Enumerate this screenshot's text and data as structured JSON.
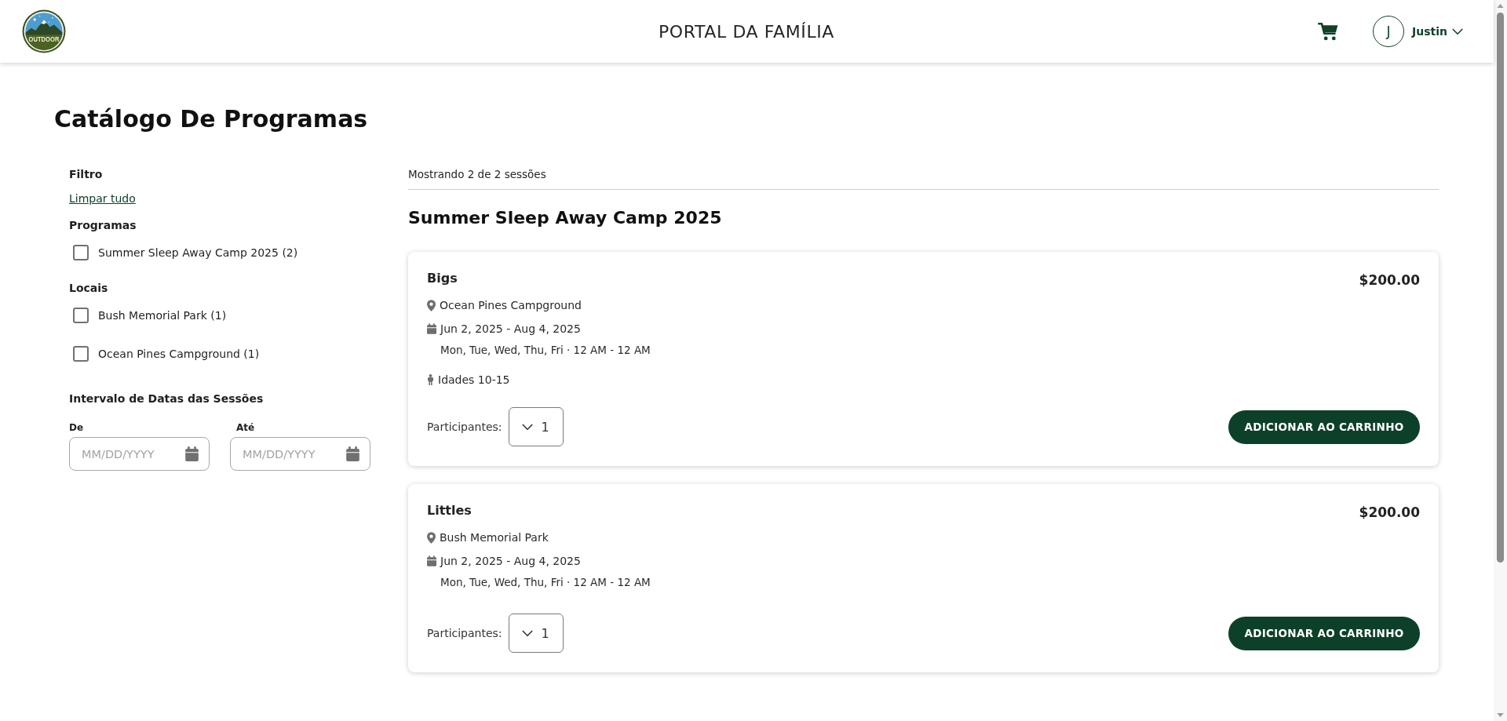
{
  "header": {
    "logo_text": "OUTDOOR",
    "title": "PORTAL DA FAMÍLIA",
    "user": {
      "initial": "J",
      "name": "Justin"
    }
  },
  "page_title": "Catálogo De Programas",
  "filters": {
    "title": "Filtro",
    "clear_link": "Limpar tudo",
    "groups": [
      {
        "title": "Programas",
        "options": [
          {
            "label": "Summer Sleep Away Camp 2025 (2)",
            "checked": false
          }
        ]
      },
      {
        "title": "Locais",
        "options": [
          {
            "label": "Bush Memorial Park (1)",
            "checked": false
          },
          {
            "label": "Ocean Pines Campground (1)",
            "checked": false
          }
        ]
      }
    ],
    "date_range": {
      "title": "Intervalo de Datas das Sessões",
      "fields": [
        {
          "label": "De",
          "placeholder": "MM/DD/YYYY"
        },
        {
          "label": "Até",
          "placeholder": "MM/DD/YYYY"
        }
      ]
    }
  },
  "results": {
    "summary": "Mostrando 2 de 2 sessões",
    "program_title": "Summer Sleep Away Camp 2025",
    "sessions": [
      {
        "name": "Bigs",
        "price": "$200.00",
        "location": "Ocean Pines Campground",
        "dates": "Jun 2, 2025 - Aug 4, 2025",
        "schedule": "Mon, Tue, Wed, Thu, Fri · 12 AM - 12 AM",
        "ages": "Idades 10-15",
        "participants": {
          "label": "Participantes:",
          "value": "1"
        },
        "button": "ADICIONAR AO CARRINHO"
      },
      {
        "name": "Littles",
        "price": "$200.00",
        "location": "Bush Memorial Park",
        "dates": "Jun 2, 2025 - Aug 4, 2025",
        "schedule": "Mon, Tue, Wed, Thu, Fri · 12 AM - 12 AM",
        "participants": {
          "label": "Participantes:",
          "value": "1"
        },
        "button": "ADICIONAR AO CARRINHO"
      }
    ]
  }
}
